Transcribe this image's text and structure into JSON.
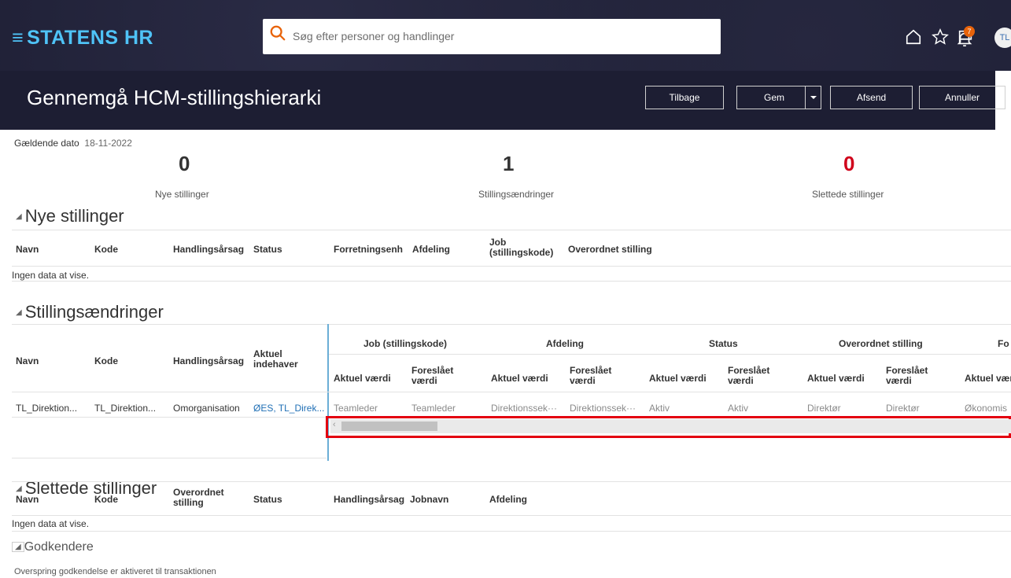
{
  "header": {
    "brand": "STATENS HR",
    "search_placeholder": "Søg efter personer og handlinger",
    "notification_count": "7",
    "avatar_initials": "TL"
  },
  "page": {
    "title": "Gennemgå HCM-stillingshierarki",
    "buttons": {
      "back": "Tilbage",
      "save": "Gem",
      "submit": "Afsend",
      "cancel": "Annuller"
    },
    "effective_date_label": "Gældende dato",
    "effective_date": "18-11-2022"
  },
  "summary": [
    {
      "value": "0",
      "label": "Nye stillinger",
      "color": "#333333"
    },
    {
      "value": "1",
      "label": "Stillingsændringer",
      "color": "#333333"
    },
    {
      "value": "0",
      "label": "Slettede stillinger",
      "color": "#d0021b"
    }
  ],
  "new_positions": {
    "title": "Nye stillinger",
    "columns": [
      "Navn",
      "Kode",
      "Handlingsårsag",
      "Status",
      "Forretningsenh",
      "Afdeling",
      "Job (stillingskode)",
      "Overordnet stilling"
    ],
    "empty_text": "Ingen data at vise."
  },
  "position_changes": {
    "title": "Stillingsændringer",
    "fixed_columns": [
      "Navn",
      "Kode",
      "Handlingsårsag",
      "Aktuel indehaver"
    ],
    "groups": [
      "Job (stillingskode)",
      "Afdeling",
      "Status",
      "Overordnet stilling",
      "Fo"
    ],
    "sub_current": "Aktuel værdi",
    "sub_proposed": "Foreslået værdi",
    "row": {
      "name": "TL_Direktion...",
      "code": "TL_Direktion...",
      "reason": "Omorganisation",
      "holder": "ØES, TL_Direk...",
      "job_current": "Teamleder",
      "job_proposed": "Teamleder",
      "dept_current": "Direktionssek···",
      "dept_proposed": "Direktionssek···",
      "status_current": "Aktiv",
      "status_proposed": "Aktiv",
      "parent_current": "Direktør",
      "parent_proposed": "Direktør",
      "next_current": "Økonomis"
    },
    "highlight_color": "#e3000f"
  },
  "deleted_positions": {
    "title": "Slettede stillinger",
    "columns": [
      "Navn",
      "Kode",
      "Overordnet stilling",
      "Status",
      "Handlingsårsag",
      "Jobnavn",
      "Afdeling"
    ],
    "empty_text": "Ingen data at vise."
  },
  "approvers": {
    "title": "Godkendere",
    "note": "Overspring godkendelse er aktiveret til transaktionen"
  }
}
